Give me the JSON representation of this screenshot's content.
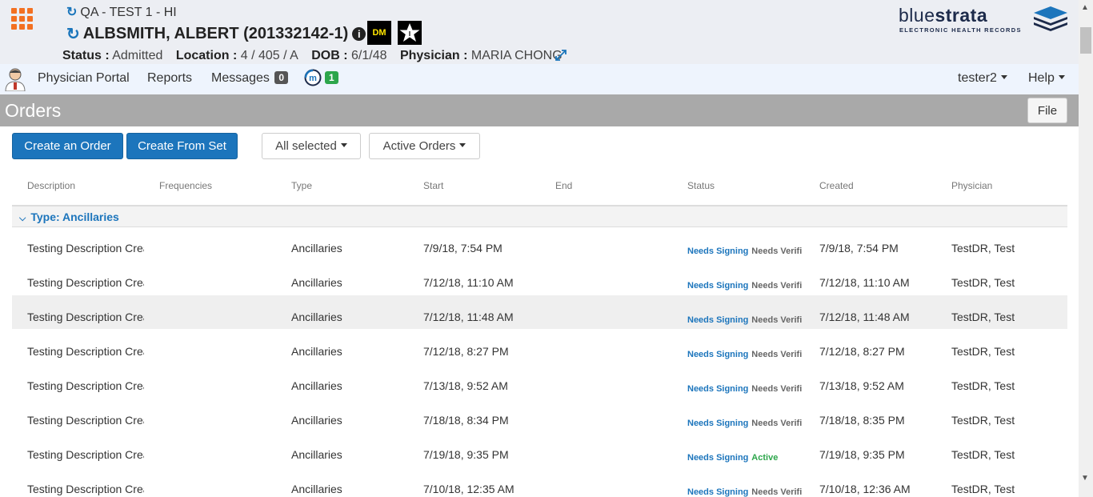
{
  "header": {
    "context": "QA - TEST 1 - HI",
    "patient": "ALBSMITH, ALBERT (201332142-1)",
    "badge_dm": "DM",
    "status_label": "Status :",
    "status_value": "Admitted",
    "location_label": "Location :",
    "location_value": "4 / 405 / A",
    "dob_label": "DOB :",
    "dob_value": "6/1/48",
    "physician_label": "Physician :",
    "physician_value": "MARIA CHONG",
    "logo_light": "blue",
    "logo_bold": "strata",
    "logo_sub": "ELECTRONIC HEALTH RECORDS"
  },
  "nav": {
    "physician_portal": "Physician Portal",
    "reports": "Reports",
    "messages": "Messages",
    "messages_count": "0",
    "m_count": "1",
    "user": "tester2",
    "help": "Help"
  },
  "page": {
    "title": "Orders",
    "file": "File"
  },
  "toolbar": {
    "create_order": "Create an Order",
    "create_from_set": "Create From Set",
    "all_selected": "All selected",
    "active_orders": "Active Orders"
  },
  "table": {
    "columns": [
      "Description",
      "Frequencies",
      "Type",
      "Start",
      "End",
      "Status",
      "Created",
      "Physician"
    ],
    "group": "Type: Ancillaries",
    "rows": [
      {
        "description": "Testing Description Crea",
        "type": "Ancillaries",
        "start": "7/9/18, 7:54 PM",
        "status1": "Needs Signing",
        "status2": "Needs Verifi",
        "created": "7/9/18, 7:54 PM",
        "physician": "TestDR, Test"
      },
      {
        "description": "Testing Description Crea",
        "type": "Ancillaries",
        "start": "7/12/18, 11:10 AM",
        "status1": "Needs Signing",
        "status2": "Needs Verifi",
        "created": "7/12/18, 11:10 AM",
        "physician": "TestDR, Test"
      },
      {
        "description": "Testing Description Crea",
        "type": "Ancillaries",
        "start": "7/12/18, 11:48 AM",
        "status1": "Needs Signing",
        "status2": "Needs Verifi",
        "created": "7/12/18, 11:48 AM",
        "physician": "TestDR, Test"
      },
      {
        "description": "Testing Description Crea",
        "type": "Ancillaries",
        "start": "7/12/18, 8:27 PM",
        "status1": "Needs Signing",
        "status2": "Needs Verifi",
        "created": "7/12/18, 8:27 PM",
        "physician": "TestDR, Test"
      },
      {
        "description": "Testing Description Crea",
        "type": "Ancillaries",
        "start": "7/13/18, 9:52 AM",
        "status1": "Needs Signing",
        "status2": "Needs Verifi",
        "created": "7/13/18, 9:52 AM",
        "physician": "TestDR, Test"
      },
      {
        "description": "Testing Description Crea",
        "type": "Ancillaries",
        "start": "7/18/18, 8:34 PM",
        "status1": "Needs Signing",
        "status2": "Needs Verifi",
        "created": "7/18/18, 8:35 PM",
        "physician": "TestDR, Test"
      },
      {
        "description": "Testing Description Crea",
        "type": "Ancillaries",
        "start": "7/19/18, 9:35 PM",
        "status1": "Needs Signing",
        "status2": "Active",
        "created": "7/19/18, 9:35 PM",
        "physician": "TestDR, Test"
      },
      {
        "description": "Testing Description Crea",
        "type": "Ancillaries",
        "start": "7/10/18, 12:35 AM",
        "status1": "Needs Signing",
        "status2": "Needs Verifi",
        "created": "7/10/18, 12:36 AM",
        "physician": "TestDR, Test"
      }
    ]
  },
  "colors": {
    "accent": "#1c75bc",
    "apps_icon": "#f37021",
    "active_status": "#2da64b"
  }
}
